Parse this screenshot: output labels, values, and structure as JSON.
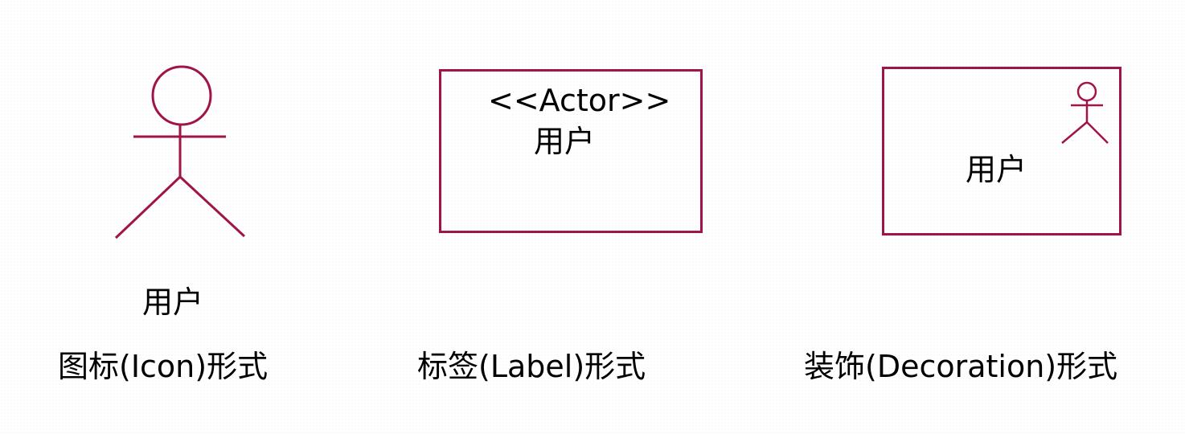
{
  "colors": {
    "accent": "#a0144a"
  },
  "icon_form": {
    "icon": "actor-stick-figure-icon",
    "name": "用户",
    "caption": "图标(Icon)形式"
  },
  "label_form": {
    "stereotype": "<<Actor>>",
    "name": "用户",
    "caption": "标签(Label)形式"
  },
  "decoration_form": {
    "icon": "actor-stick-figure-icon",
    "name": "用户",
    "caption": "装饰(Decoration)形式"
  }
}
